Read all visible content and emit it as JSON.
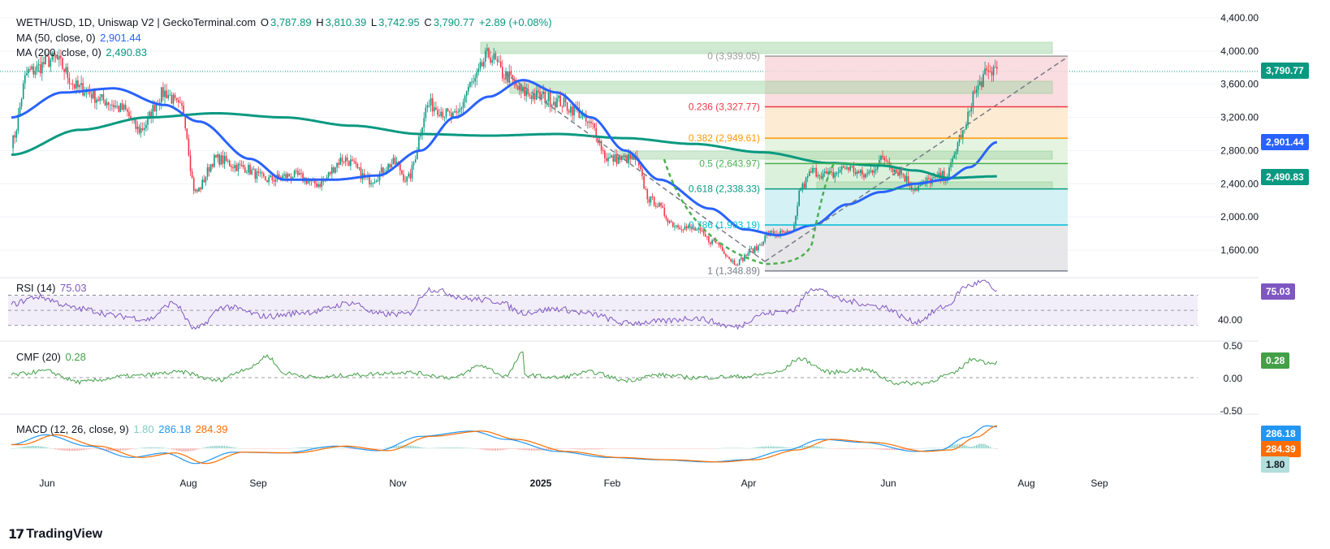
{
  "header": {
    "title": "WETH/USD, 1D, Uniswap V2 | GeckoTerminal.com",
    "open_label": "O",
    "open": "3,787.89",
    "high_label": "H",
    "high": "3,810.39",
    "low_label": "L",
    "low": "3,742.95",
    "close_label": "C",
    "close": "3,790.77",
    "change": "+2.89 (+0.08%)",
    "ma50_label": "MA (50, close, 0)",
    "ma50_value": "2,901.44",
    "ma200_label": "MA (200, close, 0)",
    "ma200_value": "2,490.83"
  },
  "rsi": {
    "label": "RSI (14)",
    "value": "75.03",
    "tick": "40.00"
  },
  "cmf": {
    "label": "CMF (20)",
    "value": "0.28",
    "ticks": [
      "0.50",
      "0.00",
      "-0.50"
    ]
  },
  "macd": {
    "label": "MACD (12, 26, close, 9)",
    "hist": "1.80",
    "macd": "286.18",
    "signal": "284.39"
  },
  "price_axis": [
    "4,400.00",
    "4,000.00",
    "3,600.00",
    "3,200.00",
    "2,800.00",
    "2,400.00",
    "2,000.00",
    "1,600.00"
  ],
  "badges": {
    "price": "3,790.77",
    "ma50": "2,901.44",
    "ma200": "2,490.83"
  },
  "x_ticks": [
    "Jun",
    "Aug",
    "Sep",
    "Nov",
    "2025",
    "Feb",
    "Apr",
    "Jun",
    "Aug",
    "Sep"
  ],
  "fib_levels": [
    {
      "ratio": "0",
      "price": "3,939.05"
    },
    {
      "ratio": "0.236",
      "price": "3,327.77"
    },
    {
      "ratio": "0.382",
      "price": "2,949.61"
    },
    {
      "ratio": "0.5",
      "price": "2,643.97"
    },
    {
      "ratio": "0.618",
      "price": "2,338.33"
    },
    {
      "ratio": "0.786",
      "price": "1,903.19"
    },
    {
      "ratio": "1",
      "price": "1,348.89"
    }
  ],
  "brand": "TradingView",
  "colors": {
    "up": "#089981",
    "down": "#f23645",
    "ma50": "#2962ff",
    "ma200": "#089981",
    "rsi": "#7e57c2",
    "cmf": "#43a047",
    "macd": "#2196f3",
    "signal": "#ff6d00"
  },
  "chart_data": {
    "type": "candlestick",
    "title": "WETH/USD, 1D, Uniswap V2 | GeckoTerminal.com",
    "ylim": [
      1300,
      4500
    ],
    "price_anchors": [
      {
        "d": 0,
        "v": 2900
      },
      {
        "d": 10,
        "v": 3750
      },
      {
        "d": 25,
        "v": 3900
      },
      {
        "d": 40,
        "v": 3550
      },
      {
        "d": 55,
        "v": 3400
      },
      {
        "d": 65,
        "v": 3300
      },
      {
        "d": 75,
        "v": 3050
      },
      {
        "d": 90,
        "v": 3500
      },
      {
        "d": 100,
        "v": 3300
      },
      {
        "d": 108,
        "v": 2300
      },
      {
        "d": 120,
        "v": 2700
      },
      {
        "d": 135,
        "v": 2600
      },
      {
        "d": 150,
        "v": 2450
      },
      {
        "d": 165,
        "v": 2500
      },
      {
        "d": 180,
        "v": 2400
      },
      {
        "d": 195,
        "v": 2700
      },
      {
        "d": 210,
        "v": 2450
      },
      {
        "d": 225,
        "v": 2650
      },
      {
        "d": 232,
        "v": 2450
      },
      {
        "d": 245,
        "v": 3350
      },
      {
        "d": 260,
        "v": 3200
      },
      {
        "d": 270,
        "v": 3600
      },
      {
        "d": 280,
        "v": 3950
      },
      {
        "d": 290,
        "v": 3700
      },
      {
        "d": 300,
        "v": 3500
      },
      {
        "d": 310,
        "v": 3450
      },
      {
        "d": 320,
        "v": 3400
      },
      {
        "d": 330,
        "v": 3300
      },
      {
        "d": 340,
        "v": 3100
      },
      {
        "d": 350,
        "v": 2700
      },
      {
        "d": 365,
        "v": 2700
      },
      {
        "d": 375,
        "v": 2200
      },
      {
        "d": 390,
        "v": 1900
      },
      {
        "d": 400,
        "v": 1850
      },
      {
        "d": 412,
        "v": 1700
      },
      {
        "d": 425,
        "v": 1450
      },
      {
        "d": 435,
        "v": 1600
      },
      {
        "d": 445,
        "v": 1800
      },
      {
        "d": 458,
        "v": 1800
      },
      {
        "d": 463,
        "v": 2350
      },
      {
        "d": 470,
        "v": 2550
      },
      {
        "d": 480,
        "v": 2500
      },
      {
        "d": 490,
        "v": 2600
      },
      {
        "d": 500,
        "v": 2500
      },
      {
        "d": 512,
        "v": 2700
      },
      {
        "d": 520,
        "v": 2550
      },
      {
        "d": 530,
        "v": 2350
      },
      {
        "d": 540,
        "v": 2450
      },
      {
        "d": 548,
        "v": 2500
      },
      {
        "d": 558,
        "v": 3000
      },
      {
        "d": 565,
        "v": 3500
      },
      {
        "d": 571,
        "v": 3700
      },
      {
        "d": 578,
        "v": 3800
      }
    ],
    "ma50_anchors": [
      {
        "d": 0,
        "v": 3200
      },
      {
        "d": 30,
        "v": 3500
      },
      {
        "d": 60,
        "v": 3550
      },
      {
        "d": 90,
        "v": 3350
      },
      {
        "d": 110,
        "v": 3150
      },
      {
        "d": 140,
        "v": 2700
      },
      {
        "d": 160,
        "v": 2450
      },
      {
        "d": 190,
        "v": 2450
      },
      {
        "d": 215,
        "v": 2500
      },
      {
        "d": 240,
        "v": 2800
      },
      {
        "d": 260,
        "v": 3200
      },
      {
        "d": 280,
        "v": 3450
      },
      {
        "d": 300,
        "v": 3650
      },
      {
        "d": 320,
        "v": 3500
      },
      {
        "d": 340,
        "v": 3200
      },
      {
        "d": 360,
        "v": 2800
      },
      {
        "d": 380,
        "v": 2450
      },
      {
        "d": 410,
        "v": 2100
      },
      {
        "d": 430,
        "v": 1850
      },
      {
        "d": 450,
        "v": 1780
      },
      {
        "d": 470,
        "v": 1900
      },
      {
        "d": 490,
        "v": 2150
      },
      {
        "d": 510,
        "v": 2300
      },
      {
        "d": 530,
        "v": 2400
      },
      {
        "d": 548,
        "v": 2450
      },
      {
        "d": 562,
        "v": 2600
      },
      {
        "d": 578,
        "v": 2901
      }
    ],
    "ma200_anchors": [
      {
        "d": 0,
        "v": 2750
      },
      {
        "d": 40,
        "v": 3050
      },
      {
        "d": 80,
        "v": 3200
      },
      {
        "d": 120,
        "v": 3250
      },
      {
        "d": 160,
        "v": 3200
      },
      {
        "d": 200,
        "v": 3100
      },
      {
        "d": 240,
        "v": 3000
      },
      {
        "d": 280,
        "v": 2980
      },
      {
        "d": 320,
        "v": 3000
      },
      {
        "d": 360,
        "v": 2950
      },
      {
        "d": 400,
        "v": 2880
      },
      {
        "d": 440,
        "v": 2780
      },
      {
        "d": 480,
        "v": 2650
      },
      {
        "d": 510,
        "v": 2620
      },
      {
        "d": 530,
        "v": 2560
      },
      {
        "d": 550,
        "v": 2470
      },
      {
        "d": 578,
        "v": 2490
      }
    ],
    "rsi_range": [
      20,
      90
    ],
    "rsi_levels": [
      70,
      50,
      30
    ],
    "rsi_anchors": [
      {
        "d": 0,
        "v": 58
      },
      {
        "d": 15,
        "v": 68
      },
      {
        "d": 40,
        "v": 52
      },
      {
        "d": 65,
        "v": 42
      },
      {
        "d": 80,
        "v": 38
      },
      {
        "d": 95,
        "v": 60
      },
      {
        "d": 108,
        "v": 25
      },
      {
        "d": 125,
        "v": 55
      },
      {
        "d": 150,
        "v": 42
      },
      {
        "d": 175,
        "v": 48
      },
      {
        "d": 200,
        "v": 60
      },
      {
        "d": 215,
        "v": 45
      },
      {
        "d": 232,
        "v": 45
      },
      {
        "d": 245,
        "v": 78
      },
      {
        "d": 270,
        "v": 65
      },
      {
        "d": 285,
        "v": 62
      },
      {
        "d": 300,
        "v": 47
      },
      {
        "d": 320,
        "v": 52
      },
      {
        "d": 340,
        "v": 45
      },
      {
        "d": 360,
        "v": 33
      },
      {
        "d": 380,
        "v": 35
      },
      {
        "d": 400,
        "v": 40
      },
      {
        "d": 425,
        "v": 28
      },
      {
        "d": 440,
        "v": 45
      },
      {
        "d": 458,
        "v": 50
      },
      {
        "d": 470,
        "v": 80
      },
      {
        "d": 490,
        "v": 62
      },
      {
        "d": 510,
        "v": 55
      },
      {
        "d": 530,
        "v": 35
      },
      {
        "d": 548,
        "v": 55
      },
      {
        "d": 560,
        "v": 82
      },
      {
        "d": 570,
        "v": 88
      },
      {
        "d": 578,
        "v": 75
      }
    ],
    "cmf_range": [
      -0.6,
      0.6
    ],
    "cmf_anchors": [
      {
        "d": 0,
        "v": 0.05
      },
      {
        "d": 20,
        "v": 0.12
      },
      {
        "d": 40,
        "v": -0.08
      },
      {
        "d": 70,
        "v": 0.03
      },
      {
        "d": 100,
        "v": 0.1
      },
      {
        "d": 120,
        "v": -0.05
      },
      {
        "d": 140,
        "v": 0.18
      },
      {
        "d": 150,
        "v": 0.4
      },
      {
        "d": 160,
        "v": 0.08
      },
      {
        "d": 180,
        "v": 0.0
      },
      {
        "d": 200,
        "v": 0.05
      },
      {
        "d": 230,
        "v": 0.1
      },
      {
        "d": 260,
        "v": 0.0
      },
      {
        "d": 275,
        "v": 0.22
      },
      {
        "d": 290,
        "v": 0.03
      },
      {
        "d": 300,
        "v": 0.45
      },
      {
        "d": 301,
        "v": 0.05
      },
      {
        "d": 320,
        "v": 0.0
      },
      {
        "d": 340,
        "v": 0.1
      },
      {
        "d": 360,
        "v": -0.05
      },
      {
        "d": 380,
        "v": 0.05
      },
      {
        "d": 400,
        "v": 0.0
      },
      {
        "d": 430,
        "v": 0.02
      },
      {
        "d": 450,
        "v": 0.1
      },
      {
        "d": 462,
        "v": 0.35
      },
      {
        "d": 480,
        "v": 0.1
      },
      {
        "d": 500,
        "v": 0.15
      },
      {
        "d": 520,
        "v": -0.1
      },
      {
        "d": 535,
        "v": -0.1
      },
      {
        "d": 550,
        "v": 0.05
      },
      {
        "d": 565,
        "v": 0.35
      },
      {
        "d": 572,
        "v": 0.28
      },
      {
        "d": 578,
        "v": 0.28
      }
    ],
    "macd_range": [
      -300,
      400
    ],
    "macd_anchors": [
      {
        "d": 0,
        "v": 50
      },
      {
        "d": 20,
        "v": 180
      },
      {
        "d": 45,
        "v": 30
      },
      {
        "d": 70,
        "v": -120
      },
      {
        "d": 90,
        "v": -60
      },
      {
        "d": 108,
        "v": -200
      },
      {
        "d": 130,
        "v": -50
      },
      {
        "d": 160,
        "v": -60
      },
      {
        "d": 190,
        "v": 30
      },
      {
        "d": 215,
        "v": -30
      },
      {
        "d": 240,
        "v": 160
      },
      {
        "d": 270,
        "v": 230
      },
      {
        "d": 290,
        "v": 120
      },
      {
        "d": 320,
        "v": -40
      },
      {
        "d": 350,
        "v": -120
      },
      {
        "d": 380,
        "v": -150
      },
      {
        "d": 410,
        "v": -180
      },
      {
        "d": 430,
        "v": -150
      },
      {
        "d": 455,
        "v": -20
      },
      {
        "d": 475,
        "v": 120
      },
      {
        "d": 500,
        "v": 80
      },
      {
        "d": 530,
        "v": -40
      },
      {
        "d": 545,
        "v": -20
      },
      {
        "d": 560,
        "v": 150
      },
      {
        "d": 572,
        "v": 300
      },
      {
        "d": 578,
        "v": 286
      }
    ]
  }
}
